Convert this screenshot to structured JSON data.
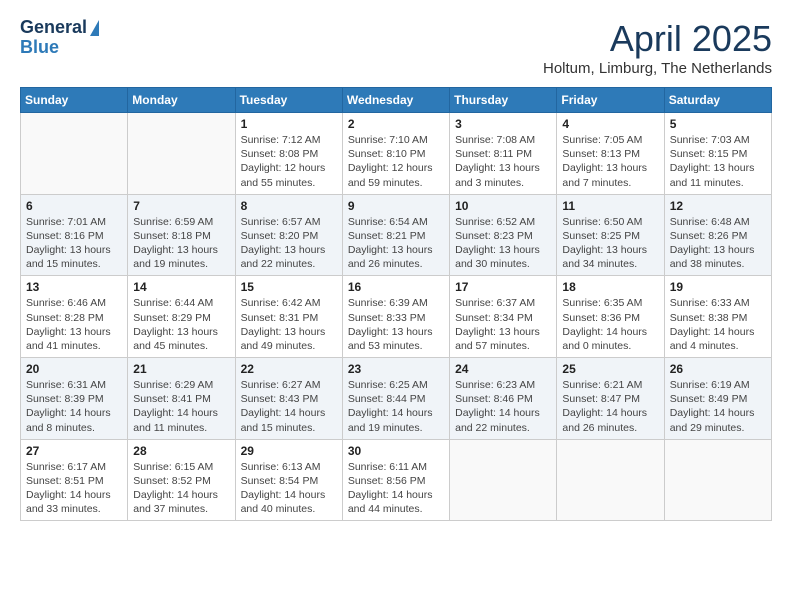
{
  "logo": {
    "general": "General",
    "blue": "Blue"
  },
  "title": "April 2025",
  "subtitle": "Holtum, Limburg, The Netherlands",
  "headers": [
    "Sunday",
    "Monday",
    "Tuesday",
    "Wednesday",
    "Thursday",
    "Friday",
    "Saturday"
  ],
  "weeks": [
    [
      {
        "day": "",
        "sunrise": "",
        "sunset": "",
        "daylight": ""
      },
      {
        "day": "",
        "sunrise": "",
        "sunset": "",
        "daylight": ""
      },
      {
        "day": "1",
        "sunrise": "Sunrise: 7:12 AM",
        "sunset": "Sunset: 8:08 PM",
        "daylight": "Daylight: 12 hours and 55 minutes."
      },
      {
        "day": "2",
        "sunrise": "Sunrise: 7:10 AM",
        "sunset": "Sunset: 8:10 PM",
        "daylight": "Daylight: 12 hours and 59 minutes."
      },
      {
        "day": "3",
        "sunrise": "Sunrise: 7:08 AM",
        "sunset": "Sunset: 8:11 PM",
        "daylight": "Daylight: 13 hours and 3 minutes."
      },
      {
        "day": "4",
        "sunrise": "Sunrise: 7:05 AM",
        "sunset": "Sunset: 8:13 PM",
        "daylight": "Daylight: 13 hours and 7 minutes."
      },
      {
        "day": "5",
        "sunrise": "Sunrise: 7:03 AM",
        "sunset": "Sunset: 8:15 PM",
        "daylight": "Daylight: 13 hours and 11 minutes."
      }
    ],
    [
      {
        "day": "6",
        "sunrise": "Sunrise: 7:01 AM",
        "sunset": "Sunset: 8:16 PM",
        "daylight": "Daylight: 13 hours and 15 minutes."
      },
      {
        "day": "7",
        "sunrise": "Sunrise: 6:59 AM",
        "sunset": "Sunset: 8:18 PM",
        "daylight": "Daylight: 13 hours and 19 minutes."
      },
      {
        "day": "8",
        "sunrise": "Sunrise: 6:57 AM",
        "sunset": "Sunset: 8:20 PM",
        "daylight": "Daylight: 13 hours and 22 minutes."
      },
      {
        "day": "9",
        "sunrise": "Sunrise: 6:54 AM",
        "sunset": "Sunset: 8:21 PM",
        "daylight": "Daylight: 13 hours and 26 minutes."
      },
      {
        "day": "10",
        "sunrise": "Sunrise: 6:52 AM",
        "sunset": "Sunset: 8:23 PM",
        "daylight": "Daylight: 13 hours and 30 minutes."
      },
      {
        "day": "11",
        "sunrise": "Sunrise: 6:50 AM",
        "sunset": "Sunset: 8:25 PM",
        "daylight": "Daylight: 13 hours and 34 minutes."
      },
      {
        "day": "12",
        "sunrise": "Sunrise: 6:48 AM",
        "sunset": "Sunset: 8:26 PM",
        "daylight": "Daylight: 13 hours and 38 minutes."
      }
    ],
    [
      {
        "day": "13",
        "sunrise": "Sunrise: 6:46 AM",
        "sunset": "Sunset: 8:28 PM",
        "daylight": "Daylight: 13 hours and 41 minutes."
      },
      {
        "day": "14",
        "sunrise": "Sunrise: 6:44 AM",
        "sunset": "Sunset: 8:29 PM",
        "daylight": "Daylight: 13 hours and 45 minutes."
      },
      {
        "day": "15",
        "sunrise": "Sunrise: 6:42 AM",
        "sunset": "Sunset: 8:31 PM",
        "daylight": "Daylight: 13 hours and 49 minutes."
      },
      {
        "day": "16",
        "sunrise": "Sunrise: 6:39 AM",
        "sunset": "Sunset: 8:33 PM",
        "daylight": "Daylight: 13 hours and 53 minutes."
      },
      {
        "day": "17",
        "sunrise": "Sunrise: 6:37 AM",
        "sunset": "Sunset: 8:34 PM",
        "daylight": "Daylight: 13 hours and 57 minutes."
      },
      {
        "day": "18",
        "sunrise": "Sunrise: 6:35 AM",
        "sunset": "Sunset: 8:36 PM",
        "daylight": "Daylight: 14 hours and 0 minutes."
      },
      {
        "day": "19",
        "sunrise": "Sunrise: 6:33 AM",
        "sunset": "Sunset: 8:38 PM",
        "daylight": "Daylight: 14 hours and 4 minutes."
      }
    ],
    [
      {
        "day": "20",
        "sunrise": "Sunrise: 6:31 AM",
        "sunset": "Sunset: 8:39 PM",
        "daylight": "Daylight: 14 hours and 8 minutes."
      },
      {
        "day": "21",
        "sunrise": "Sunrise: 6:29 AM",
        "sunset": "Sunset: 8:41 PM",
        "daylight": "Daylight: 14 hours and 11 minutes."
      },
      {
        "day": "22",
        "sunrise": "Sunrise: 6:27 AM",
        "sunset": "Sunset: 8:43 PM",
        "daylight": "Daylight: 14 hours and 15 minutes."
      },
      {
        "day": "23",
        "sunrise": "Sunrise: 6:25 AM",
        "sunset": "Sunset: 8:44 PM",
        "daylight": "Daylight: 14 hours and 19 minutes."
      },
      {
        "day": "24",
        "sunrise": "Sunrise: 6:23 AM",
        "sunset": "Sunset: 8:46 PM",
        "daylight": "Daylight: 14 hours and 22 minutes."
      },
      {
        "day": "25",
        "sunrise": "Sunrise: 6:21 AM",
        "sunset": "Sunset: 8:47 PM",
        "daylight": "Daylight: 14 hours and 26 minutes."
      },
      {
        "day": "26",
        "sunrise": "Sunrise: 6:19 AM",
        "sunset": "Sunset: 8:49 PM",
        "daylight": "Daylight: 14 hours and 29 minutes."
      }
    ],
    [
      {
        "day": "27",
        "sunrise": "Sunrise: 6:17 AM",
        "sunset": "Sunset: 8:51 PM",
        "daylight": "Daylight: 14 hours and 33 minutes."
      },
      {
        "day": "28",
        "sunrise": "Sunrise: 6:15 AM",
        "sunset": "Sunset: 8:52 PM",
        "daylight": "Daylight: 14 hours and 37 minutes."
      },
      {
        "day": "29",
        "sunrise": "Sunrise: 6:13 AM",
        "sunset": "Sunset: 8:54 PM",
        "daylight": "Daylight: 14 hours and 40 minutes."
      },
      {
        "day": "30",
        "sunrise": "Sunrise: 6:11 AM",
        "sunset": "Sunset: 8:56 PM",
        "daylight": "Daylight: 14 hours and 44 minutes."
      },
      {
        "day": "",
        "sunrise": "",
        "sunset": "",
        "daylight": ""
      },
      {
        "day": "",
        "sunrise": "",
        "sunset": "",
        "daylight": ""
      },
      {
        "day": "",
        "sunrise": "",
        "sunset": "",
        "daylight": ""
      }
    ]
  ]
}
